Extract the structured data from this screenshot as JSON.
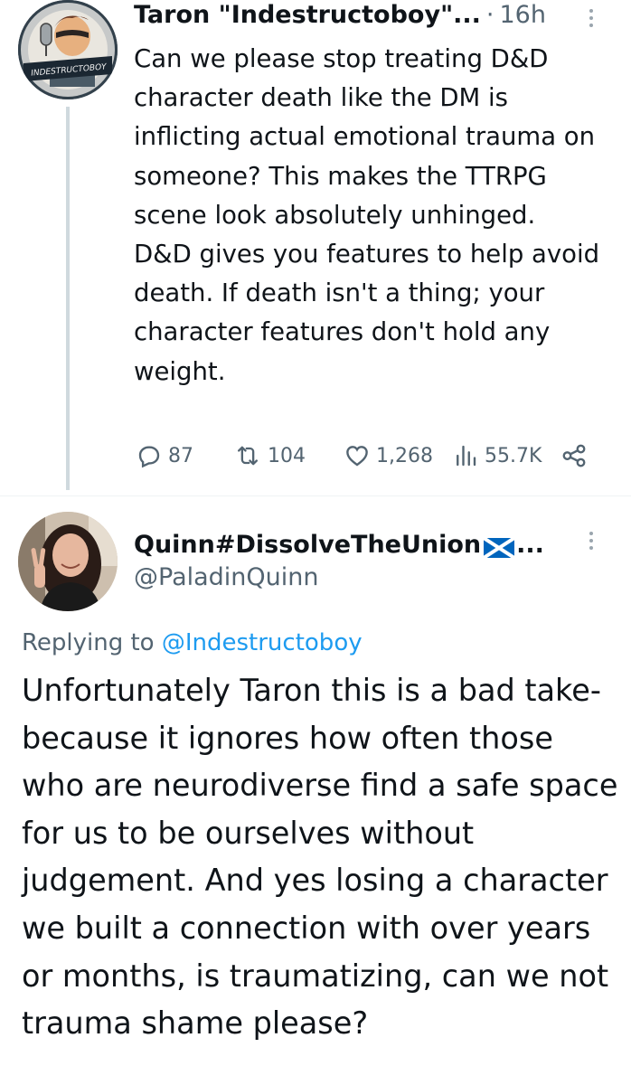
{
  "tweet": {
    "author_name": "Taron \"Indestructoboy\"...",
    "separator": "·",
    "time": "16h",
    "avatar_text": "INDESTRUCTOBOY",
    "paragraph1": "Can we please stop treating D&D character death like the DM is inflicting actual emotional trauma on someone? This makes the TTRPG scene look absolutely unhinged.",
    "paragraph2": "D&D gives you features to help avoid death. If death isn't a thing; your character features don't hold any weight.",
    "stats": {
      "replies": "87",
      "retweets": "104",
      "likes": "1,268",
      "views": "55.7K"
    }
  },
  "reply": {
    "author_name": "Quinn#DissolveTheUnion",
    "name_suffix": "...",
    "handle": "@PaladinQuinn",
    "replying_prefix": "Replying to",
    "replying_to": "@Indestructoboy",
    "body": "Unfortunately Taron this is a bad take-because it ignores how often those who are neurodiverse find a safe space for us to be ourselves without judgement. And yes losing a character we built a connection with over years or months, is traumatizing, can we not trauma shame please?"
  },
  "icons": {
    "reply": "reply-icon",
    "retweet": "retweet-icon",
    "like": "heart-icon",
    "views": "views-icon",
    "share": "share-icon",
    "more": "more-options-icon",
    "flag": "scotland-flag-icon"
  },
  "colors": {
    "text": "#0f1419",
    "secondary": "#536471",
    "link": "#1d9bf0",
    "thread_line": "#cfd9de",
    "flag_blue": "#0065bd"
  }
}
